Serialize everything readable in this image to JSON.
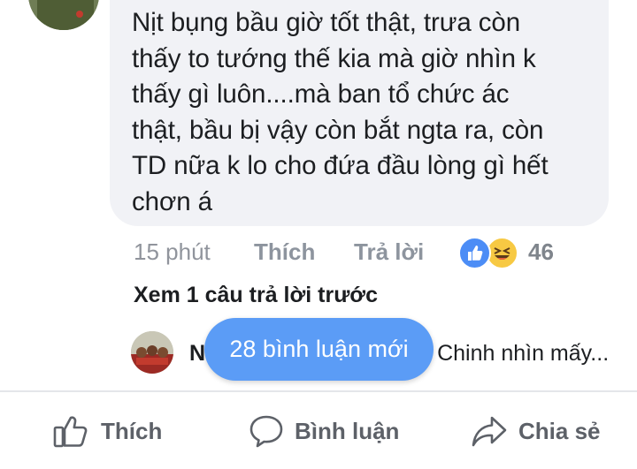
{
  "comment": {
    "text": "Nịt bụng bầu giờ tốt thật, trưa còn\nthấy to tướng thế kia mà giờ nhìn k\nthấy gì luôn....mà ban tổ chức ác\nthật, bầu bị vậy còn bắt ngta ra, còn\nTD nữa k lo cho đứa đầu lòng gì hết\nchơn á",
    "time": "15 phút",
    "like_label": "Thích",
    "reply_label": "Trả lời",
    "reaction_count": "46",
    "reaction_icons": [
      "like-reaction-icon",
      "haha-reaction-icon"
    ]
  },
  "replies": {
    "view_previous_label": "Xem 1 câu trả lời trước",
    "preview_name": "N",
    "preview_text": "Chinh nhìn mấy..."
  },
  "toast": {
    "label": "28 bình luận mới"
  },
  "action_bar": {
    "like_label": "Thích",
    "comment_label": "Bình luận",
    "share_label": "Chia sẻ"
  },
  "colors": {
    "bubble": "#f1f2f6",
    "toast": "#5b9cf6",
    "like_reaction": "#4c8df6",
    "haha_reaction": "#f7c943",
    "meta_text": "#90949c"
  }
}
